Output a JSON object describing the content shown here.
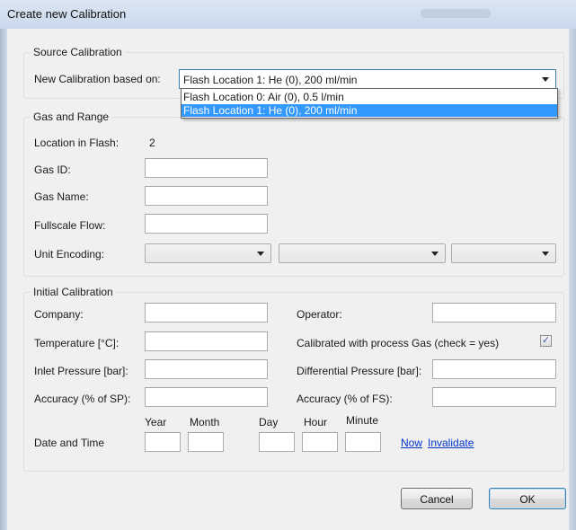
{
  "window": {
    "title": "Create new Calibration"
  },
  "source_calibration": {
    "legend": "Source Calibration",
    "based_on_label": "New Calibration based on:",
    "selected": "Flash Location 1: He (0), 200 ml/min",
    "options": [
      "Flash Location 0: Air (0), 0.5 l/min",
      "Flash Location 1: He (0), 200 ml/min"
    ]
  },
  "gas_and_range": {
    "legend": "Gas and Range",
    "location_label": "Location in Flash:",
    "location_value": "2",
    "gas_id_label": "Gas ID:",
    "gas_name_label": "Gas Name:",
    "fullscale_label": "Fullscale Flow:",
    "unit_encoding_label": "Unit Encoding:"
  },
  "initial_calibration": {
    "legend": "Initial Calibration",
    "company_label": "Company:",
    "temperature_label": "Temperature [°C]:",
    "inlet_pressure_label": "Inlet Pressure [bar]:",
    "accuracy_sp_label": "Accuracy (% of SP):",
    "operator_label": "Operator:",
    "process_gas_label": "Calibrated with process Gas (check = yes)",
    "process_gas_checked": true,
    "diff_pressure_label": "Differential Pressure [bar]:",
    "accuracy_fs_label": "Accuracy (% of FS):",
    "date_time_label": "Date and Time",
    "year_label": "Year",
    "month_label": "Month",
    "day_label": "Day",
    "hour_label": "Hour",
    "minute_label": "Minute",
    "now_link": "Now",
    "invalidate_link": "Invalidate"
  },
  "buttons": {
    "cancel": "Cancel",
    "ok": "OK"
  },
  "colors": {
    "selection": "#3399ff",
    "link": "#0033cc",
    "dialog_bg": "#f0f0f0"
  }
}
